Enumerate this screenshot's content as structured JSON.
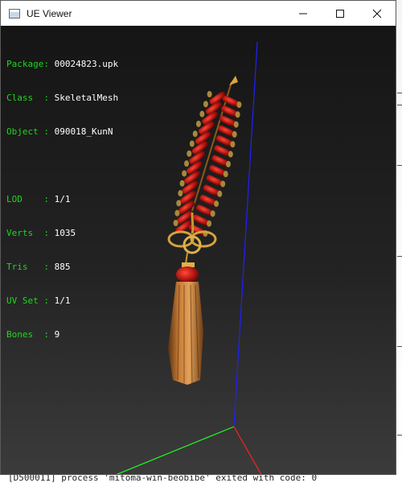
{
  "window": {
    "title": "UE Viewer"
  },
  "colors": {
    "label": "#1ed81e",
    "value": "#ffffff",
    "axis_x": "#ff2020",
    "axis_y": "#20ff20",
    "axis_z": "#2020ff"
  },
  "info": {
    "package_label": "Package:",
    "package_value": "00024823.upk",
    "class_label": "Class  :",
    "class_value": "SkeletalMesh",
    "object_label": "Object :",
    "object_value": "090018_KunN",
    "lod_label": "LOD    :",
    "lod_value": "1/1",
    "verts_label": "Verts  :",
    "verts_value": "1035",
    "tris_label": "Tris   :",
    "tris_value": "885",
    "uvset_label": "UV Set :",
    "uvset_value": "1/1",
    "bones_label": "Bones  :",
    "bones_value": "9"
  },
  "background": {
    "console_line": "[D500011] process 'mitoma-win-beobibe' exited with code: 0"
  },
  "icons": {
    "app": "window-app-icon",
    "minimize": "minimize-icon",
    "maximize": "maximize-icon",
    "close": "close-icon"
  }
}
